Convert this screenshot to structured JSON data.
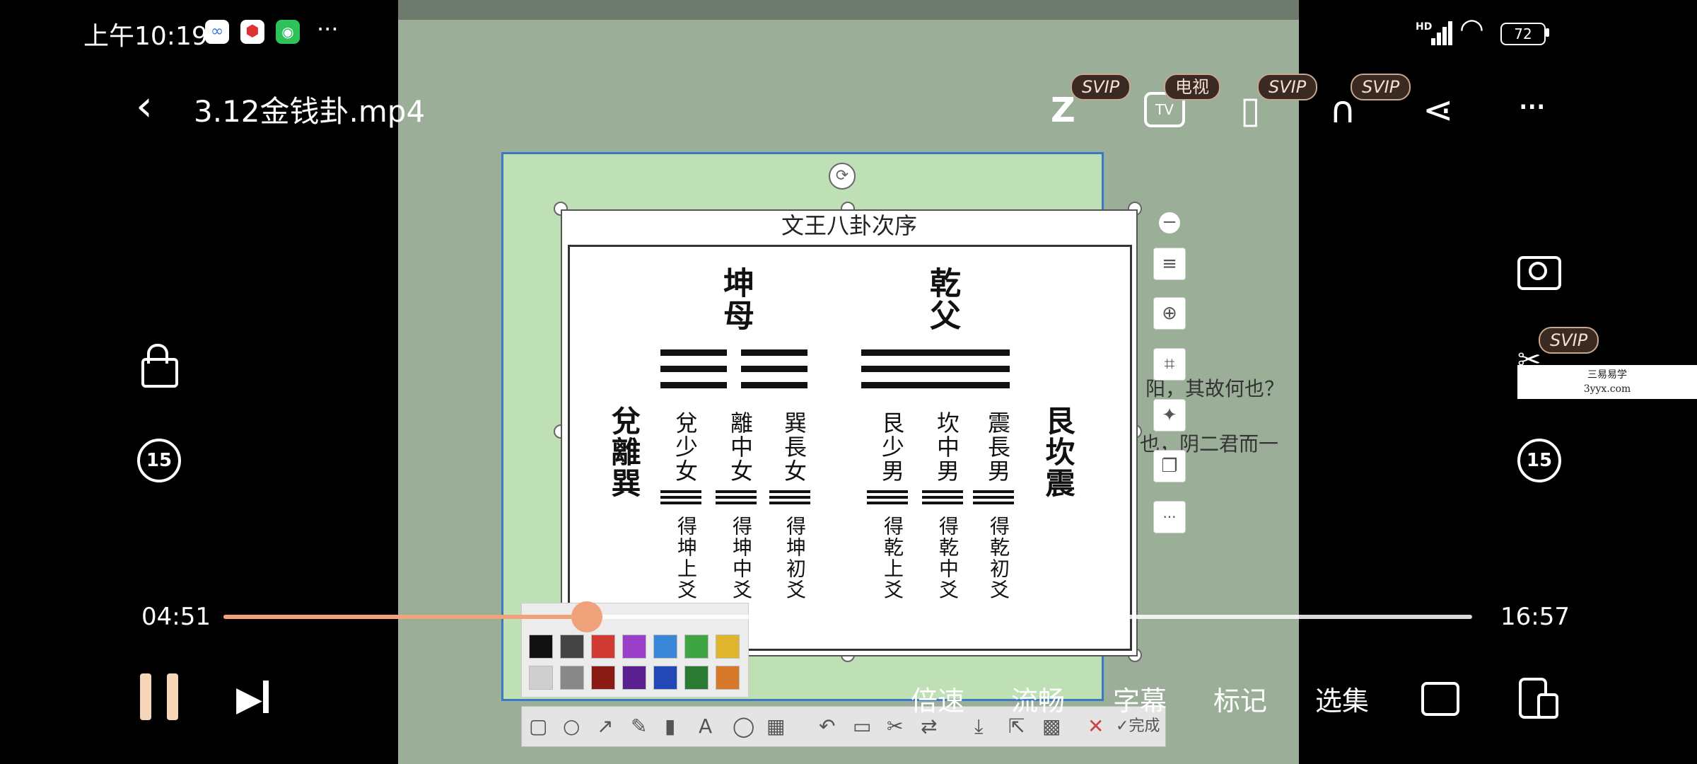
{
  "status_bar": {
    "time": "上午10:19",
    "more": "···",
    "signal": "HD",
    "battery": "72"
  },
  "player": {
    "title": "3.12金钱卦.mp4",
    "badges": {
      "svip": "SVIP",
      "tv": "电视"
    },
    "elapsed": "04:51",
    "total": "16:57",
    "progress": 0.291,
    "skip_back": "15",
    "skip_fwd": "15",
    "menu": {
      "speed": "倍速",
      "quality": "流畅",
      "subtitle": "字幕",
      "mark": "标记",
      "episodes": "选集"
    }
  },
  "video": {
    "slide_title": "文王八卦次序",
    "kun": "坤母",
    "qian": "乾父",
    "left_group": "兌離巽",
    "right_group": "艮坎震",
    "daughters": [
      "兌少女",
      "離中女",
      "巽長女"
    ],
    "sons": [
      "艮少男",
      "坎中男",
      "震長男"
    ],
    "daughters_get": [
      "得坤上爻",
      "得坤中爻",
      "得坤初爻"
    ],
    "sons_get": [
      "得乾上爻",
      "得乾中爻",
      "得乾初爻"
    ],
    "side_text_1": "阳，其故何也？",
    "side_text_2": "也，阴二君而一",
    "watermark_1": "三易易学",
    "watermark_2": "3yyx.com",
    "done_label": "完成",
    "toolbar_more": "···",
    "swatch_colors": [
      "#111111",
      "#444444",
      "#d03a32",
      "#9b3ec9",
      "#3a86d8",
      "#3fa444",
      "#e0b52e",
      "#cfcfcf",
      "#888888",
      "#8a1a14",
      "#5a2090",
      "#2248b8",
      "#2a7a34",
      "#d8782a"
    ]
  },
  "colors": {
    "accent": "#f0a27a",
    "badge_bg": "#3a2a22",
    "badge_text": "#f2dfcf"
  }
}
